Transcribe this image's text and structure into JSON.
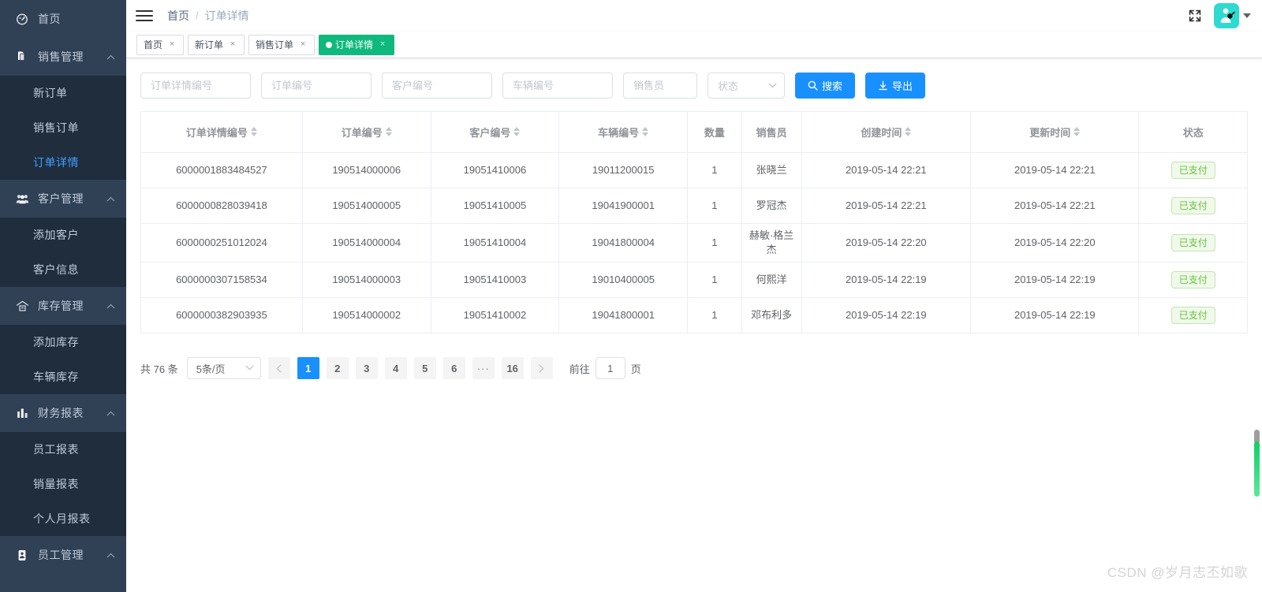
{
  "sidebar": {
    "groups": [
      {
        "label": "首页",
        "icon": "dashboard-icon",
        "collapsible": false,
        "children": []
      },
      {
        "label": "销售管理",
        "icon": "document-copy-icon",
        "collapsible": true,
        "children": [
          {
            "label": "新订单",
            "active": false
          },
          {
            "label": "销售订单",
            "active": false
          },
          {
            "label": "订单详情",
            "active": true
          }
        ]
      },
      {
        "label": "客户管理",
        "icon": "users-icon",
        "collapsible": true,
        "children": [
          {
            "label": "添加客户",
            "active": false
          },
          {
            "label": "客户信息",
            "active": false
          }
        ]
      },
      {
        "label": "库存管理",
        "icon": "warehouse-icon",
        "collapsible": true,
        "children": [
          {
            "label": "添加库存",
            "active": false
          },
          {
            "label": "车辆库存",
            "active": false
          }
        ]
      },
      {
        "label": "财务报表",
        "icon": "bar-chart-icon",
        "collapsible": true,
        "children": [
          {
            "label": "员工报表",
            "active": false
          },
          {
            "label": "销量报表",
            "active": false
          },
          {
            "label": "个人月报表",
            "active": false
          }
        ]
      },
      {
        "label": "员工管理",
        "icon": "id-card-icon",
        "collapsible": true,
        "children": []
      }
    ]
  },
  "navbar": {
    "hamburger_icon": "hamburger-icon",
    "breadcrumb": {
      "home": "首页",
      "separator": "/",
      "current": "订单详情"
    },
    "fullscreen_icon": "fullscreen-icon",
    "avatar_icon": "user-avatar-icon",
    "caret_icon": "caret-down-icon"
  },
  "tags": [
    {
      "label": "首页",
      "active": false,
      "close": "×"
    },
    {
      "label": "新订单",
      "active": false,
      "close": "×"
    },
    {
      "label": "销售订单",
      "active": false,
      "close": "×"
    },
    {
      "label": "订单详情",
      "active": true,
      "close": "×"
    }
  ],
  "filters": {
    "order_detail_no_placeholder": "订单详情编号",
    "order_no_placeholder": "订单编号",
    "customer_no_placeholder": "客户编号",
    "vehicle_no_placeholder": "车辆编号",
    "salesman_placeholder": "销售员",
    "status_placeholder": "状态",
    "order_detail_no_value": "",
    "order_no_value": "",
    "customer_no_value": "",
    "vehicle_no_value": "",
    "salesman_value": "",
    "search_label": "搜索",
    "search_icon": "search-icon",
    "export_label": "导出",
    "export_icon": "download-icon",
    "primary_color": "#1890ff"
  },
  "table": {
    "columns": [
      {
        "label": "订单详情编号",
        "sortable": true,
        "width": "14.6%"
      },
      {
        "label": "订单编号",
        "sortable": true,
        "width": "11.6%"
      },
      {
        "label": "客户编号",
        "sortable": true,
        "width": "11.6%"
      },
      {
        "label": "车辆编号",
        "sortable": true,
        "width": "11.6%"
      },
      {
        "label": "数量",
        "sortable": false,
        "width": "4.9%"
      },
      {
        "label": "销售员",
        "sortable": false,
        "width": "5.4%"
      },
      {
        "label": "创建时间",
        "sortable": true,
        "width": "15.3%"
      },
      {
        "label": "更新时间",
        "sortable": true,
        "width": "15.2%"
      },
      {
        "label": "状态",
        "sortable": false,
        "width": "9.8%"
      }
    ],
    "rows": [
      {
        "order_detail_no": "6000001883484527",
        "order_no": "190514000006",
        "customer_no": "19051410006",
        "vehicle_no": "19011200015",
        "quantity": "1",
        "salesman": "张晓兰",
        "created_at": "2019-05-14 22:21",
        "updated_at": "2019-05-14 22:21",
        "status": "已支付"
      },
      {
        "order_detail_no": "6000000828039418",
        "order_no": "190514000005",
        "customer_no": "19051410005",
        "vehicle_no": "19041900001",
        "quantity": "1",
        "salesman": "罗冠杰",
        "created_at": "2019-05-14 22:21",
        "updated_at": "2019-05-14 22:21",
        "status": "已支付"
      },
      {
        "order_detail_no": "6000000251012024",
        "order_no": "190514000004",
        "customer_no": "19051410004",
        "vehicle_no": "19041800004",
        "quantity": "1",
        "salesman": "赫敏·格兰杰",
        "created_at": "2019-05-14 22:20",
        "updated_at": "2019-05-14 22:20",
        "status": "已支付"
      },
      {
        "order_detail_no": "6000000307158534",
        "order_no": "190514000003",
        "customer_no": "19051410003",
        "vehicle_no": "19010400005",
        "quantity": "1",
        "salesman": "何熙洋",
        "created_at": "2019-05-14 22:19",
        "updated_at": "2019-05-14 22:19",
        "status": "已支付"
      },
      {
        "order_detail_no": "6000000382903935",
        "order_no": "190514000002",
        "customer_no": "19051410002",
        "vehicle_no": "19041800001",
        "quantity": "1",
        "salesman": "邓布利多",
        "created_at": "2019-05-14 22:19",
        "updated_at": "2019-05-14 22:19",
        "status": "已支付"
      }
    ],
    "status_badge_color": "#67c23a",
    "status_badge_bg": "#f0f9eb"
  },
  "pagination": {
    "total_text": "共 76 条",
    "page_size_label": "5条/页",
    "prev_icon": "chevron-left-icon",
    "next_icon": "chevron-right-icon",
    "pages": [
      "1",
      "2",
      "3",
      "4",
      "5",
      "6"
    ],
    "ellipsis": "···",
    "last_page": "16",
    "current_page": "1",
    "jump_prefix": "前往",
    "jump_value": "1",
    "jump_suffix": "页",
    "active_color": "#1890ff"
  },
  "watermark": {
    "text": "CSDN @岁月志丕如歌"
  }
}
